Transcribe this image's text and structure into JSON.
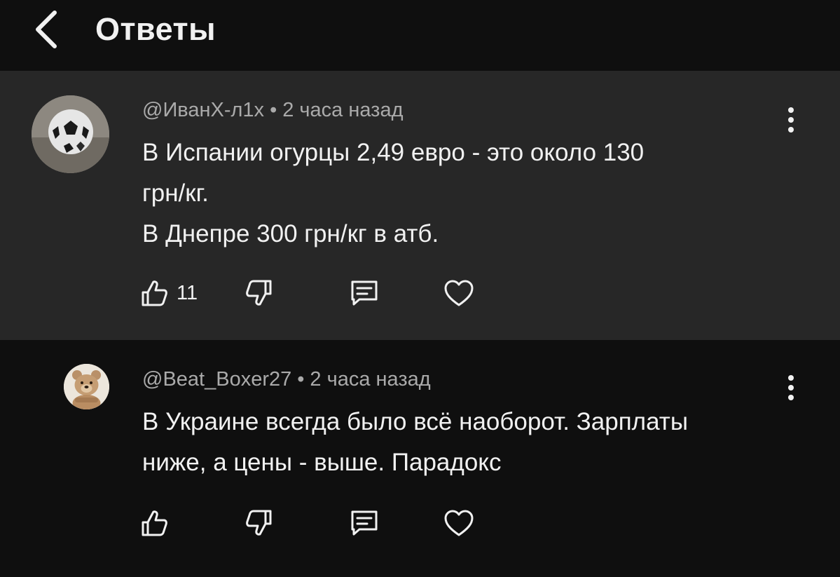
{
  "header": {
    "title": "Ответы",
    "back_icon": "chevron-left-icon"
  },
  "comments": [
    {
      "author": "@ИванХ-л1х",
      "separator": "•",
      "time": "2 часа назад",
      "text": "В Испании огурцы 2,49 евро - это около 130\nгрн/кг.\nВ Днепре 300 грн/кг в атб.",
      "likes": "11",
      "avatar": "soccer-ball-avatar",
      "highlighted": true
    },
    {
      "author": "@Beat_Boxer27",
      "separator": "•",
      "time": "2 часа назад",
      "text": "В Украине всегда было всё наоборот. Зарплаты\nниже, а цены - выше. Парадокс",
      "likes": "",
      "avatar": "teddy-bear-avatar",
      "highlighted": false
    }
  ],
  "colors": {
    "background": "#0f0f0f",
    "highlight_background": "#272727",
    "text_primary": "#f1f1f1",
    "text_secondary": "#aaaaaa"
  },
  "icons": {
    "like": "thumbs-up-icon",
    "dislike": "thumbs-down-icon",
    "reply": "comment-icon",
    "heart": "heart-icon",
    "menu": "more-vertical-icon"
  }
}
